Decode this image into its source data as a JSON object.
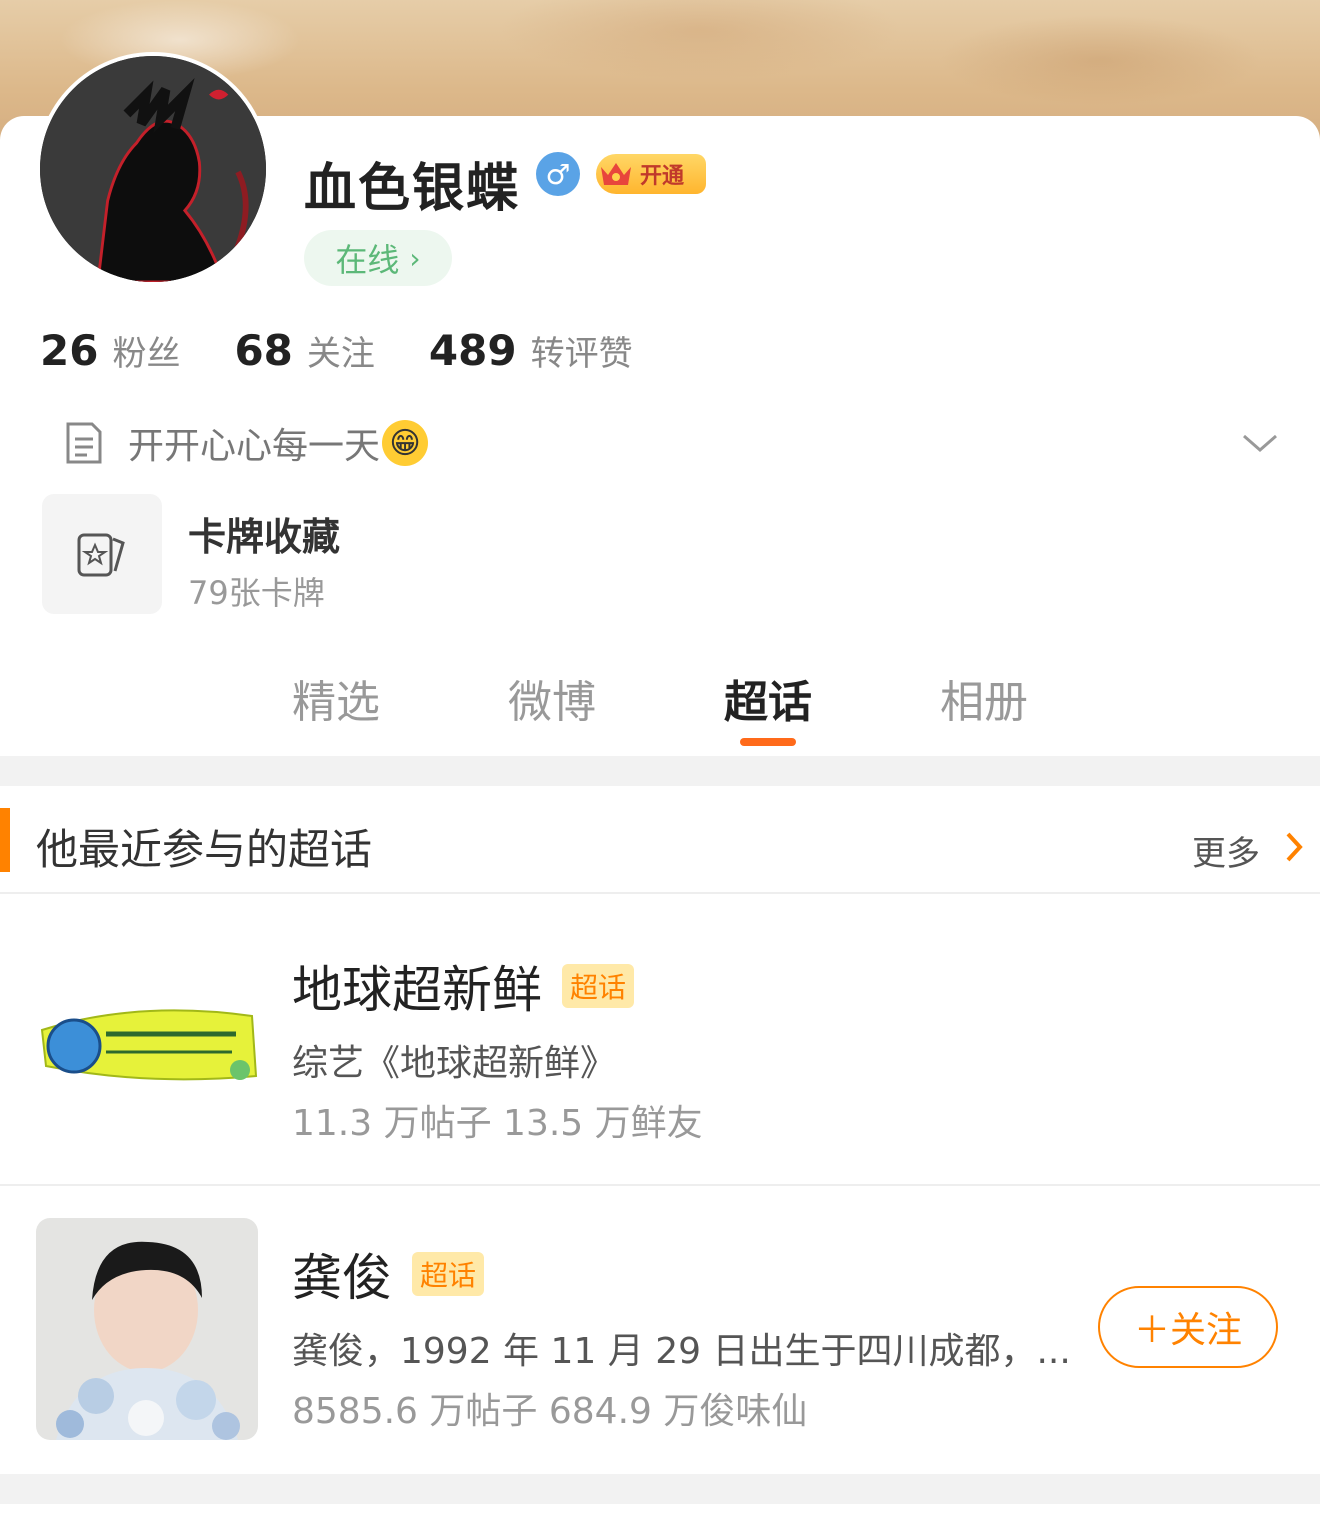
{
  "profile": {
    "username": "血色银蝶",
    "gender_icon": "male-icon",
    "gender_symbol": "♂",
    "vip_label": "开通",
    "online_label": "在线",
    "bio": "开开心心每一天",
    "bio_emoji": "😁"
  },
  "stats": [
    {
      "value": "26",
      "label": "粉丝"
    },
    {
      "value": "68",
      "label": "关注"
    },
    {
      "value": "489",
      "label": "转评赞"
    }
  ],
  "card_collection": {
    "title": "卡牌收藏",
    "count": "79张卡牌"
  },
  "tabs": [
    {
      "label": "精选",
      "active": false
    },
    {
      "label": "微博",
      "active": false
    },
    {
      "label": "超话",
      "active": true
    },
    {
      "label": "相册",
      "active": false
    }
  ],
  "section": {
    "title": "他最近参与的超话",
    "more_label": "更多"
  },
  "topics": [
    {
      "name": "地球超新鲜",
      "tag": "超话",
      "desc": "综艺《地球超新鲜》",
      "stats": "11.3 万帖子 13.5 万鲜友"
    },
    {
      "name": "龚俊",
      "tag": "超话",
      "desc": "龚俊，1992 年 11 月 29 日出生于四川成都，...",
      "stats": "8585.6 万帖子 684.9 万俊味仙",
      "follow_label": "＋关注"
    }
  ],
  "colors": {
    "accent": "#ff8200",
    "tab_underline": "#ff6a1a",
    "online_green": "#5cb878",
    "gender_blue": "#5aa3e6"
  }
}
